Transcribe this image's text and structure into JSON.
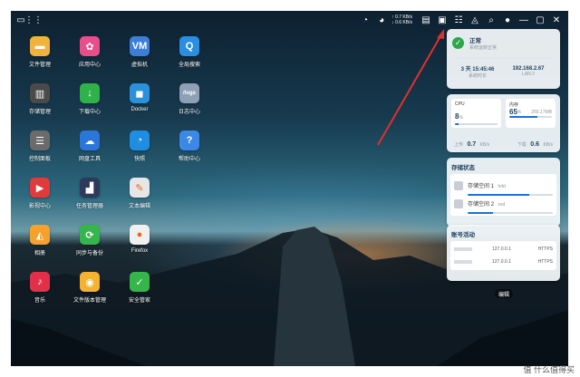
{
  "topbar": {
    "left_icons": [
      "desktop-icon",
      "app-grid-icon"
    ],
    "net_up": "0.7 KB/s",
    "net_down": "0.6 KB/s",
    "right_icons": [
      "widgets-icon",
      "task-manager-icon",
      "control-icon",
      "bell-icon",
      "search-icon",
      "user-icon",
      "minimize-icon",
      "maximize-icon",
      "close-icon"
    ]
  },
  "apps": [
    {
      "label": "文件管理",
      "color": "#f2b33d",
      "icon": "folder-icon",
      "glyph": "▬"
    },
    {
      "label": "应用中心",
      "color": "#e84f8a",
      "icon": "app-center-icon",
      "glyph": "✿"
    },
    {
      "label": "虚拟机",
      "color": "#3b7fd9",
      "icon": "vm-icon",
      "glyph": "VM"
    },
    {
      "label": "全局搜索",
      "color": "#2b8ee0",
      "icon": "search-icon",
      "glyph": "Q"
    },
    {
      "label": "存储管理",
      "color": "#4a4a4a",
      "icon": "storage-icon",
      "glyph": "▥"
    },
    {
      "label": "下载中心",
      "color": "#2fb24a",
      "icon": "download-icon",
      "glyph": "↓"
    },
    {
      "label": "Docker",
      "color": "#2a92dd",
      "icon": "docker-icon",
      "glyph": "◼"
    },
    {
      "label": "日志中心",
      "color": "#8ea0b6",
      "icon": "log-icon",
      "glyph": "/logs"
    },
    {
      "label": "控制面板",
      "color": "#6b6b6b",
      "icon": "control-panel-icon",
      "glyph": "☰"
    },
    {
      "label": "网盘工具",
      "color": "#2b77d9",
      "icon": "cloud-drive-icon",
      "glyph": "☁"
    },
    {
      "label": "快照",
      "color": "#1f8ee0",
      "icon": "snapshot-icon",
      "glyph": "◔"
    },
    {
      "label": "帮助中心",
      "color": "#3b88e6",
      "icon": "help-icon",
      "glyph": "?"
    },
    {
      "label": "影视中心",
      "color": "#e23a3a",
      "icon": "video-icon",
      "glyph": "▶"
    },
    {
      "label": "任务管理器",
      "color": "#2d3a5a",
      "icon": "task-manager-icon",
      "glyph": "▟"
    },
    {
      "label": "文本编辑",
      "color": "#e6e6e6",
      "icon": "text-editor-icon",
      "glyph": "✎"
    },
    {
      "label": "",
      "color": "",
      "icon": "",
      "glyph": ""
    },
    {
      "label": "相册",
      "color": "#f5a12e",
      "icon": "photos-icon",
      "glyph": "◭"
    },
    {
      "label": "同步与备份",
      "color": "#35b54b",
      "icon": "sync-icon",
      "glyph": "⟳"
    },
    {
      "label": "Firefox",
      "color": "#f0f0f0",
      "icon": "firefox-icon",
      "glyph": "●"
    },
    {
      "label": "",
      "color": "",
      "icon": "",
      "glyph": ""
    },
    {
      "label": "音乐",
      "color": "#e2304a",
      "icon": "music-icon",
      "glyph": "♪"
    },
    {
      "label": "文件版本管理",
      "color": "#f3b22f",
      "icon": "file-version-icon",
      "glyph": "◉"
    },
    {
      "label": "安全管家",
      "color": "#36b54b",
      "icon": "security-icon",
      "glyph": "✓"
    }
  ],
  "status": {
    "title": "正常",
    "subtitle": "系统运转正常",
    "uptime": "3 天 15:45:46",
    "uptime_label": "系统时长",
    "ip": "192.168.2.67",
    "ip_label": "LAN 2"
  },
  "resources": {
    "cpu_label": "CPU",
    "cpu_value": "8",
    "cpu_unit": "%",
    "cpu_pct": 8,
    "mem_label": "内存",
    "mem_value": "65",
    "mem_unit": "%",
    "mem_total": "255.17MB",
    "mem_pct": 65,
    "up_label": "上传",
    "up_value": "0.7",
    "up_unit": "KB/s",
    "down_label": "下载",
    "down_value": "0.6",
    "down_unit": "KB/s"
  },
  "storage": {
    "title": "存储状态",
    "items": [
      {
        "name": "存储空间 1",
        "tag": "hdd",
        "pct": 72
      },
      {
        "name": "存储空间 2",
        "tag": "ssd",
        "pct": 30
      }
    ]
  },
  "account": {
    "title": "账号活动",
    "rows": [
      {
        "ip": "127.0.0.1",
        "proto": "HTTPS"
      },
      {
        "ip": "127.0.0.1",
        "proto": "HTTPS"
      }
    ]
  },
  "edit_label": "编辑",
  "watermark": "值 什么值得买"
}
